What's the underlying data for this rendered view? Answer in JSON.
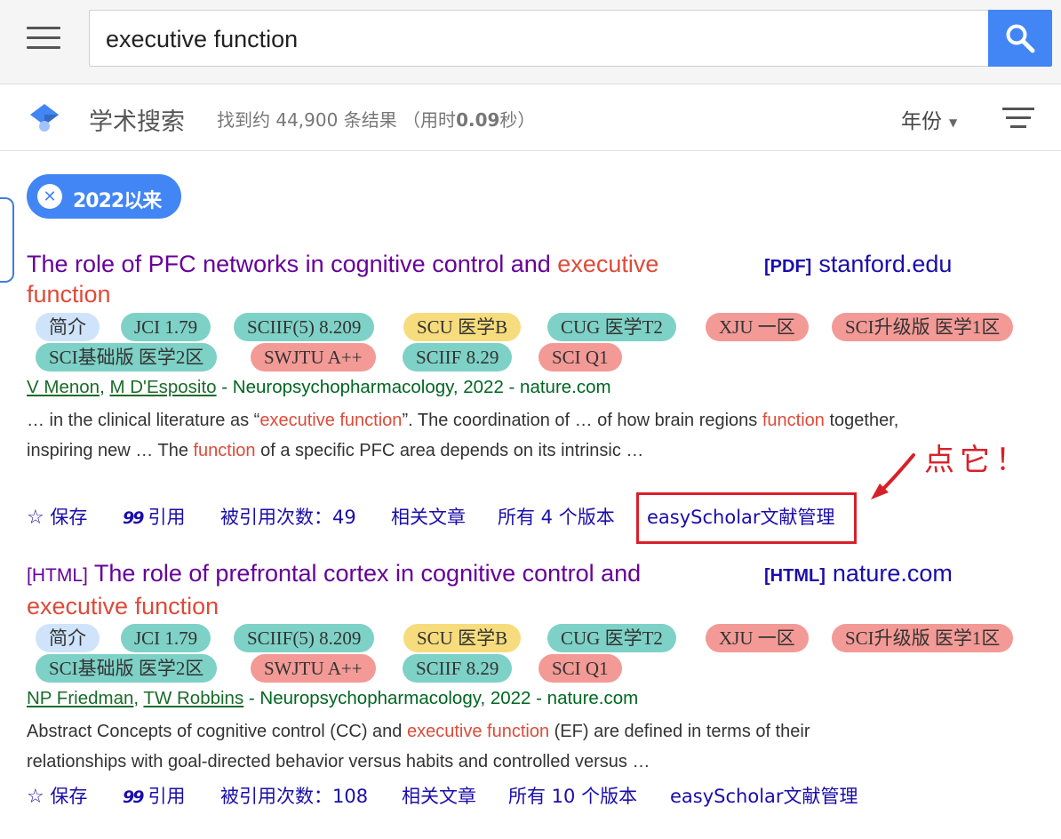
{
  "search": {
    "query": "executive function"
  },
  "header": {
    "brand": "学术搜索",
    "result_count_prefix": "找到约 44,900 条结果 （用时",
    "result_time": "0.09",
    "result_count_suffix": "秒）",
    "year_filter": "年份"
  },
  "chip": {
    "label": "2022以来"
  },
  "annotation": {
    "text": "点它！"
  },
  "results": [
    {
      "title_part1": "The role of PFC networks in cognitive control and ",
      "title_hl1": "executive",
      "title_part2": "",
      "title_hl2": "function",
      "side_format": "[PDF]",
      "side_source": "stanford.edu",
      "tags": [
        "简介",
        "JCI 1.79",
        "SCIIF(5) 8.209",
        "SCU 医学B",
        "CUG 医学T2",
        "XJU 一区",
        "SCI升级版 医学1区",
        "SCI基础版 医学2区",
        "SWJTU A++",
        "SCIIF 8.29",
        "SCI Q1"
      ],
      "author1": "V Menon",
      "author2": "M D'Esposito",
      "venue": " - Neuropsychopharmacology, 2022 - nature.com",
      "snippet": [
        "… in the clinical literature as “",
        "executive function",
        "”. The coordination of … of how brain regions ",
        "function",
        " together, inspiring new … The ",
        "function",
        " of a specific PFC area depends on its intrinsic …"
      ],
      "actions": {
        "save": "保存",
        "cite": "引用",
        "cited_by": "被引用次数：49",
        "related": "相关文章",
        "versions": "所有 4 个版本",
        "easyscholar": "easyScholar文献管理"
      }
    },
    {
      "title_prefix": "[HTML]",
      "title_part1": "The role of prefrontal cortex in cognitive control and ",
      "title_hl1": "executive function",
      "side_format": "[HTML]",
      "side_source": "nature.com",
      "tags": [
        "简介",
        "JCI 1.79",
        "SCIIF(5) 8.209",
        "SCU 医学B",
        "CUG 医学T2",
        "XJU 一区",
        "SCI升级版 医学1区",
        "SCI基础版 医学2区",
        "SWJTU A++",
        "SCIIF 8.29",
        "SCI Q1"
      ],
      "author1": "NP Friedman",
      "author2": "TW Robbins",
      "venue": " - Neuropsychopharmacology, 2022 - nature.com",
      "snippet": [
        "Abstract Concepts of cognitive control (CC) and ",
        "executive function",
        " (EF) are defined in terms of their relationships with goal-directed behavior versus habits and controlled versus …"
      ],
      "actions": {
        "save": "保存",
        "cite": "引用",
        "cited_by": "被引用次数：108",
        "related": "相关文章",
        "versions": "所有 10 个版本",
        "easyscholar": "easyScholar文献管理"
      }
    }
  ],
  "colors": {
    "accent": "#4285f4",
    "title": "#660099",
    "highlight": "#dd4b39",
    "link": "#1a0dab",
    "annotation": "#d8202a"
  },
  "icons": [
    "menu-icon",
    "search-icon",
    "scholar-logo-icon",
    "filter-icon",
    "close-icon",
    "star-icon",
    "quote-icon",
    "arrow-icon"
  ]
}
